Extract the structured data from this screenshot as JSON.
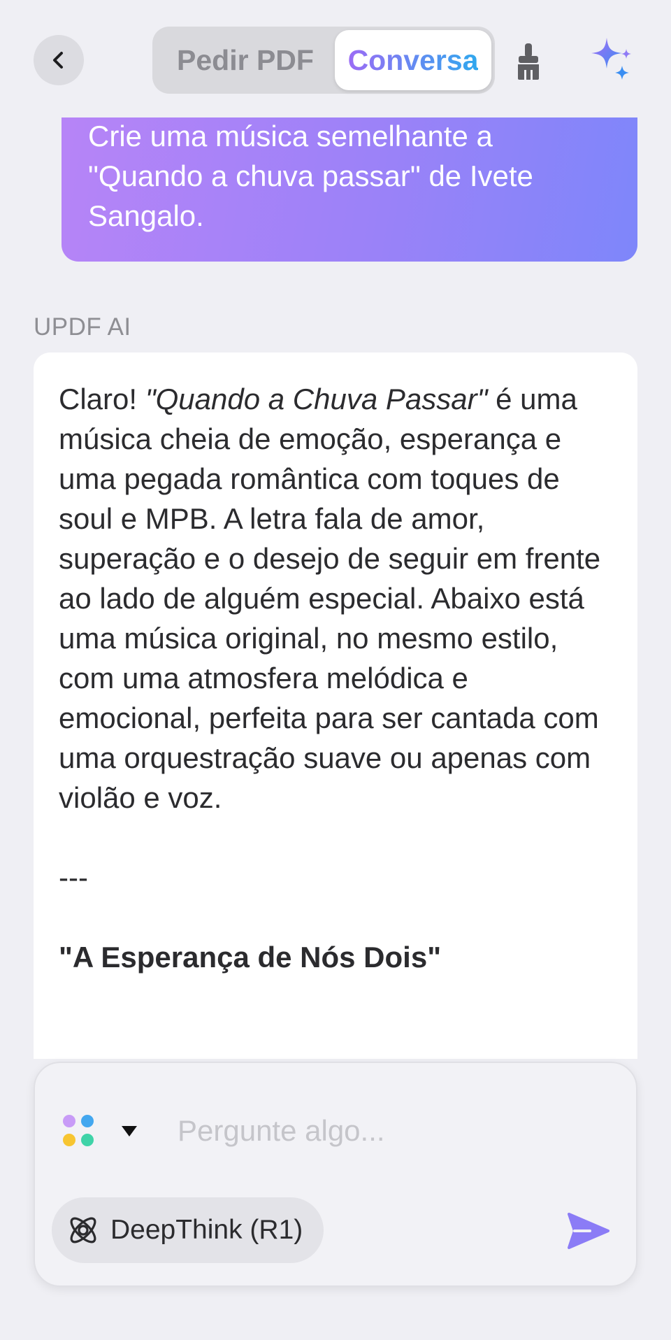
{
  "header": {
    "tabs": [
      {
        "label": "Pedir PDF",
        "active": false
      },
      {
        "label": "Conversa",
        "active": true
      }
    ],
    "icons": {
      "back": "chevron-left-icon",
      "clear": "broom-icon",
      "ai": "sparkle-icon"
    },
    "active_gradient": [
      "#9b6cf5",
      "#2fa8ee"
    ]
  },
  "chat": {
    "user_message": "Crie uma música semelhante a \"Quando a chuva passar\" de Ivete Sangalo.",
    "ai_label": "UPDF AI",
    "ai_response": {
      "intro_start": "Claro! ",
      "intro_italic": "\"Quando a Chuva Passar\"",
      "intro_rest": " é uma música cheia de emoção, esperança e uma pegada romântica com toques de soul e MPB. A letra fala de amor, superação e o desejo de seguir em frente ao lado de alguém especial. Abaixo está uma música original, no mesmo estilo, com uma atmosfera melódica e emocional, perfeita para ser cantada com uma orquestração suave ou apenas com violão e voz.",
      "separator": "---",
      "song_title": "\"A Esperança de Nós Dois\""
    },
    "user_bubble_gradient": [
      "#b784f7",
      "#7e86fa"
    ]
  },
  "input": {
    "placeholder": "Pergunte algo...",
    "model_dot_colors": [
      "#c89bf7",
      "#43a7ef",
      "#f7c531",
      "#3fd3a8"
    ],
    "deepthink_label": "DeepThink (R1)",
    "send_color": "#8b7cf6"
  }
}
